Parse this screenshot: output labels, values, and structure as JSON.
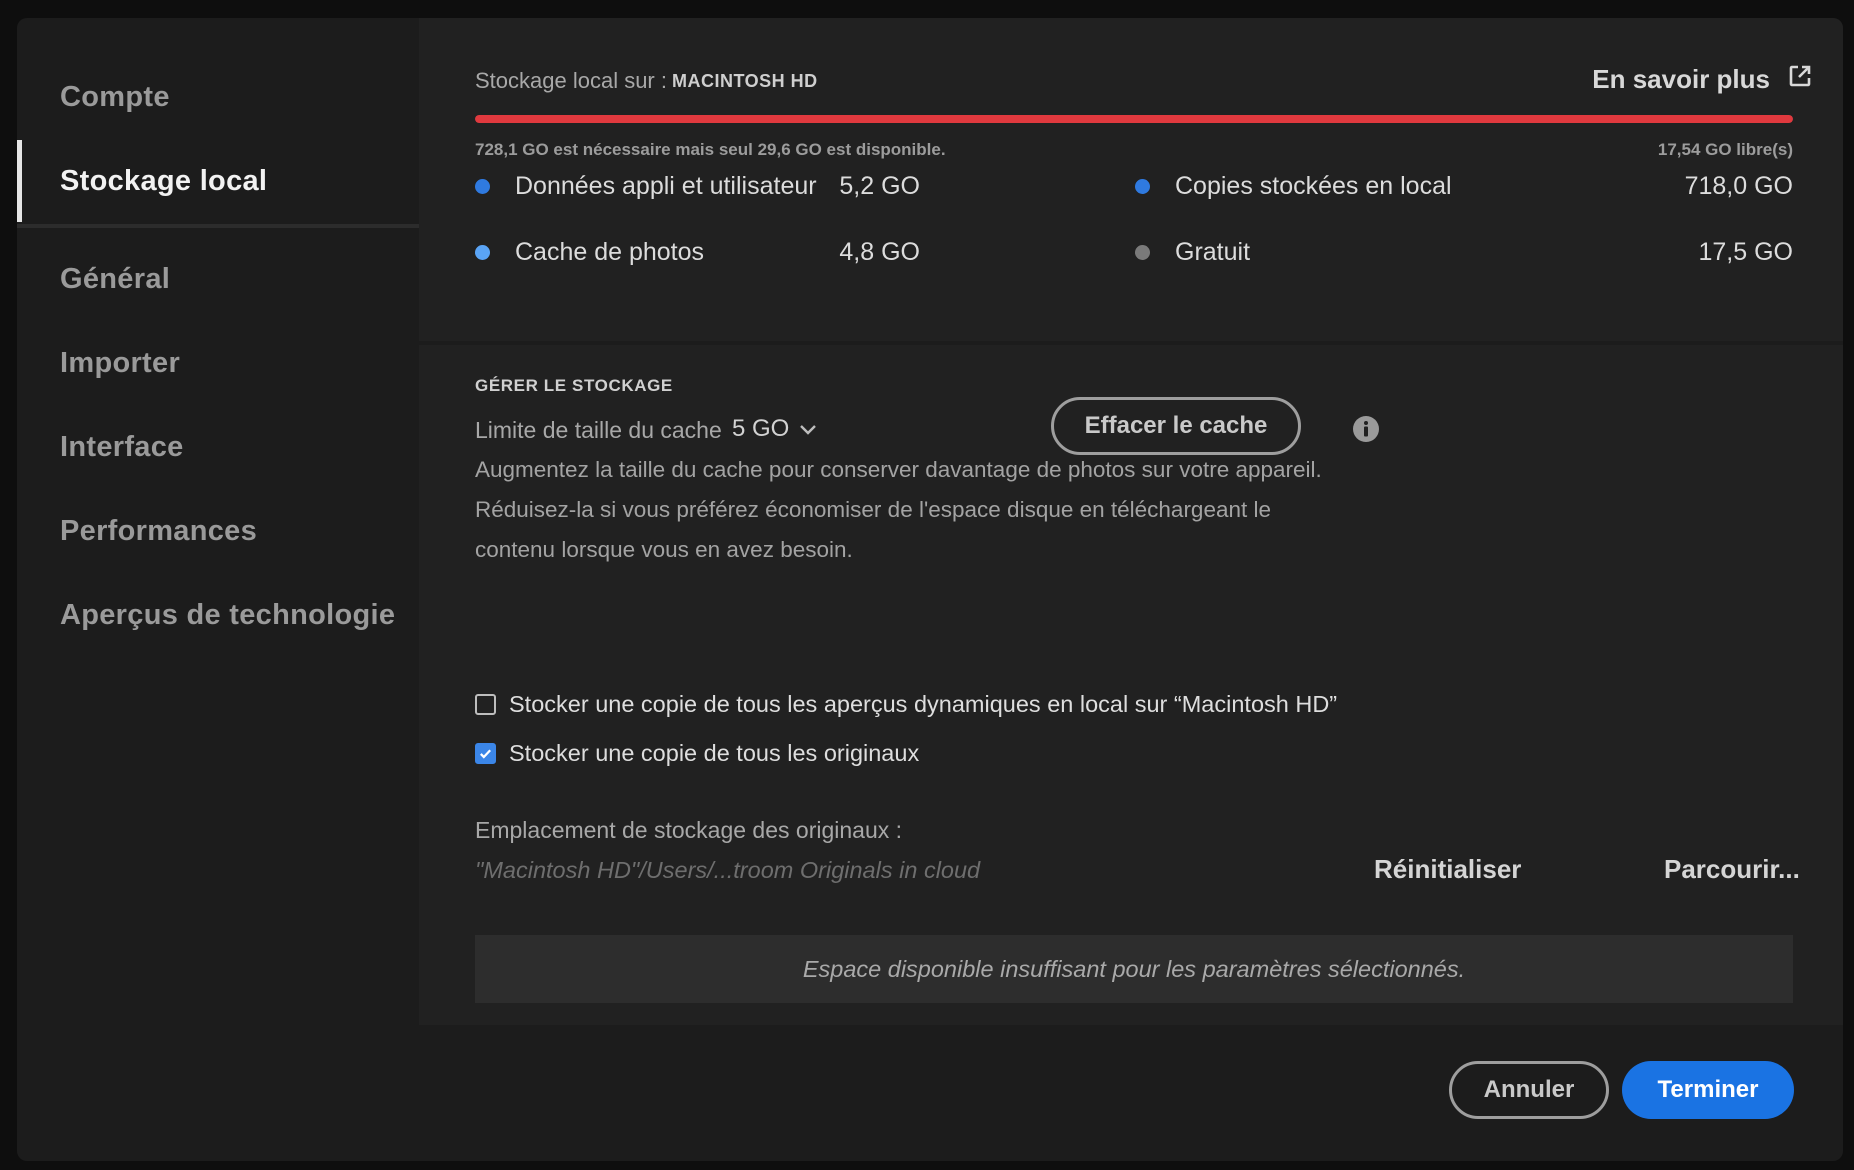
{
  "sidebar": {
    "items": [
      {
        "label": "Compte",
        "active": false
      },
      {
        "label": "Stockage local",
        "active": true
      },
      {
        "label": "Général",
        "active": false
      },
      {
        "label": "Importer",
        "active": false
      },
      {
        "label": "Interface",
        "active": false
      },
      {
        "label": "Performances",
        "active": false
      },
      {
        "label": "Aperçus de technologie",
        "active": false
      }
    ]
  },
  "storage": {
    "label": "Stockage local sur :",
    "disk": "MACINTOSH HD",
    "learn_more": "En savoir plus",
    "usage_fraction": 1.0,
    "bar_color": "#e0393e",
    "needed_text": "728,1 GO est nécessaire mais seul 29,6 GO est disponible.",
    "free_text": "17,54 GO libre(s)",
    "legend": [
      {
        "label": "Données appli et utilisateur",
        "value": "5,2 GO",
        "color": "#2f7ae0"
      },
      {
        "label": "Copies stockées en local",
        "value": "718,0 GO",
        "color": "#2f7ae0"
      },
      {
        "label": "Cache de photos",
        "value": "4,8 GO",
        "color": "#5aa4f5"
      },
      {
        "label": "Gratuit",
        "value": "17,5 GO",
        "color": "#7a7a7a"
      }
    ]
  },
  "manage": {
    "title": "GÉRER LE STOCKAGE",
    "cache_label": "Limite de taille du cache",
    "cache_value": "5 GO",
    "clear_cache": "Effacer le cache",
    "info_icon": "info-icon",
    "desc_lines": [
      "Augmentez la taille du cache pour conserver davantage de photos sur votre appareil.",
      "Réduisez-la si vous préférez économiser de l'espace disque en téléchargeant le",
      "contenu lorsque vous en avez besoin."
    ],
    "checkboxes": [
      {
        "label": "Stocker une copie de tous les aperçus dynamiques en local sur “Macintosh HD”",
        "checked": false
      },
      {
        "label": "Stocker une copie de tous les originaux",
        "checked": true
      }
    ],
    "location_label": "Emplacement de stockage des originaux :",
    "location_path": "\"Macintosh HD\"/Users/...troom Originals in cloud",
    "reset": "Réinitialiser",
    "browse": "Parcourir...",
    "warning": "Espace disponible insuffisant pour les paramètres sélectionnés."
  },
  "footer": {
    "cancel": "Annuler",
    "done": "Terminer",
    "accent": "#1a73e3"
  }
}
